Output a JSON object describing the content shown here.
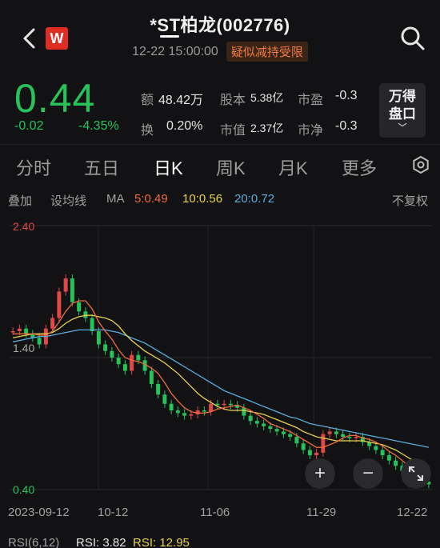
{
  "header": {
    "title": "*ST柏龙(002776)",
    "timestamp": "12-22 15:00:00",
    "badge": "疑似减持受限",
    "logo_text": "W",
    "back_icon": "chevron-left-icon",
    "search_icon": "search-icon"
  },
  "quote": {
    "price": "0.44",
    "change": "-0.02",
    "change_pct": "-4.35%",
    "stats": [
      {
        "label": "额",
        "value": "48.42万"
      },
      {
        "label": "股本",
        "value": "5.38亿"
      },
      {
        "label": "市盈",
        "value": "-0.3"
      },
      {
        "label": "换",
        "value": "0.20%"
      },
      {
        "label": "市值",
        "value": "2.37亿"
      },
      {
        "label": "市净",
        "value": "-0.3"
      }
    ],
    "panel_button": {
      "line1": "万得",
      "line2": "盘口",
      "chevron": "﹀"
    }
  },
  "tabs": [
    {
      "label": "分时",
      "active": false
    },
    {
      "label": "五日",
      "active": false
    },
    {
      "label": "日K",
      "active": true
    },
    {
      "label": "周K",
      "active": false
    },
    {
      "label": "月K",
      "active": false
    },
    {
      "label": "更多",
      "active": false
    }
  ],
  "indicators": {
    "overlay": "叠加",
    "set_ma": "设均线",
    "ma": "MA",
    "ma5": "5:0.49",
    "ma10": "10:0.56",
    "ma20": "20:0.72",
    "adjust": "不复权"
  },
  "colors": {
    "up": "#e04848",
    "down": "#27c25a",
    "ma5": "#f06a3c",
    "ma10": "#e8d24a",
    "ma20": "#59aee0",
    "background": "#121214"
  },
  "chart_data": {
    "type": "candlestick",
    "y_labels": [
      "2.40",
      "1.40",
      "0.40"
    ],
    "ylim": [
      0.4,
      2.4
    ],
    "x_labels": [
      "2023-09-12",
      "10-12",
      "11-06",
      "11-29",
      "12-22"
    ],
    "close": [
      1.6,
      1.62,
      1.58,
      1.55,
      1.5,
      1.62,
      1.7,
      1.9,
      2.0,
      1.82,
      1.75,
      1.7,
      1.6,
      1.5,
      1.45,
      1.4,
      1.35,
      1.3,
      1.42,
      1.38,
      1.3,
      1.2,
      1.12,
      1.05,
      1.0,
      0.98,
      0.96,
      0.97,
      1.0,
      0.99,
      1.05,
      1.04,
      1.05,
      1.04,
      1.02,
      0.96,
      0.92,
      0.9,
      0.88,
      0.86,
      0.84,
      0.82,
      0.8,
      0.75,
      0.7,
      0.66,
      0.68,
      0.82,
      0.84,
      0.82,
      0.8,
      0.79,
      0.8,
      0.76,
      0.73,
      0.7,
      0.66,
      0.62,
      0.58,
      0.54,
      0.5,
      0.48,
      0.46,
      0.44
    ],
    "ma5": [
      1.58,
      1.58,
      1.58,
      1.58,
      1.57,
      1.57,
      1.6,
      1.67,
      1.75,
      1.81,
      1.83,
      1.83,
      1.77,
      1.67,
      1.6,
      1.54,
      1.46,
      1.4,
      1.38,
      1.37,
      1.35,
      1.32,
      1.28,
      1.21,
      1.13,
      1.07,
      1.02,
      0.99,
      0.98,
      0.98,
      0.99,
      1.01,
      1.02,
      1.03,
      1.04,
      1.02,
      1.0,
      0.97,
      0.94,
      0.9,
      0.88,
      0.86,
      0.84,
      0.81,
      0.78,
      0.75,
      0.72,
      0.72,
      0.74,
      0.76,
      0.79,
      0.81,
      0.81,
      0.79,
      0.78,
      0.76,
      0.73,
      0.69,
      0.66,
      0.62,
      0.58,
      0.54,
      0.51,
      0.49
    ],
    "ma10": [
      1.55,
      1.56,
      1.57,
      1.58,
      1.58,
      1.58,
      1.59,
      1.62,
      1.66,
      1.69,
      1.71,
      1.72,
      1.72,
      1.71,
      1.7,
      1.68,
      1.64,
      1.58,
      1.53,
      1.49,
      1.45,
      1.42,
      1.39,
      1.36,
      1.32,
      1.28,
      1.23,
      1.18,
      1.13,
      1.09,
      1.06,
      1.03,
      1.01,
      1.0,
      1.0,
      1.0,
      0.99,
      0.98,
      0.97,
      0.95,
      0.93,
      0.91,
      0.89,
      0.87,
      0.84,
      0.82,
      0.8,
      0.79,
      0.78,
      0.77,
      0.77,
      0.77,
      0.77,
      0.77,
      0.76,
      0.75,
      0.74,
      0.72,
      0.7,
      0.67,
      0.64,
      0.61,
      0.58,
      0.56
    ],
    "ma20": [
      1.52,
      1.53,
      1.54,
      1.55,
      1.56,
      1.56,
      1.57,
      1.58,
      1.59,
      1.6,
      1.61,
      1.61,
      1.61,
      1.61,
      1.61,
      1.6,
      1.59,
      1.57,
      1.55,
      1.53,
      1.51,
      1.48,
      1.45,
      1.42,
      1.39,
      1.36,
      1.33,
      1.3,
      1.27,
      1.24,
      1.21,
      1.18,
      1.15,
      1.13,
      1.11,
      1.09,
      1.07,
      1.05,
      1.03,
      1.01,
      0.99,
      0.97,
      0.95,
      0.94,
      0.92,
      0.9,
      0.89,
      0.88,
      0.87,
      0.86,
      0.85,
      0.84,
      0.83,
      0.82,
      0.81,
      0.8,
      0.79,
      0.78,
      0.77,
      0.76,
      0.75,
      0.74,
      0.73,
      0.72
    ]
  },
  "chart_controls": {
    "zoom_in": "+",
    "zoom_out": "−"
  },
  "rsi": {
    "label": "RSI(6,12)",
    "rsi1": "RSI: 3.82",
    "rsi2": "RSI: 12.95"
  }
}
